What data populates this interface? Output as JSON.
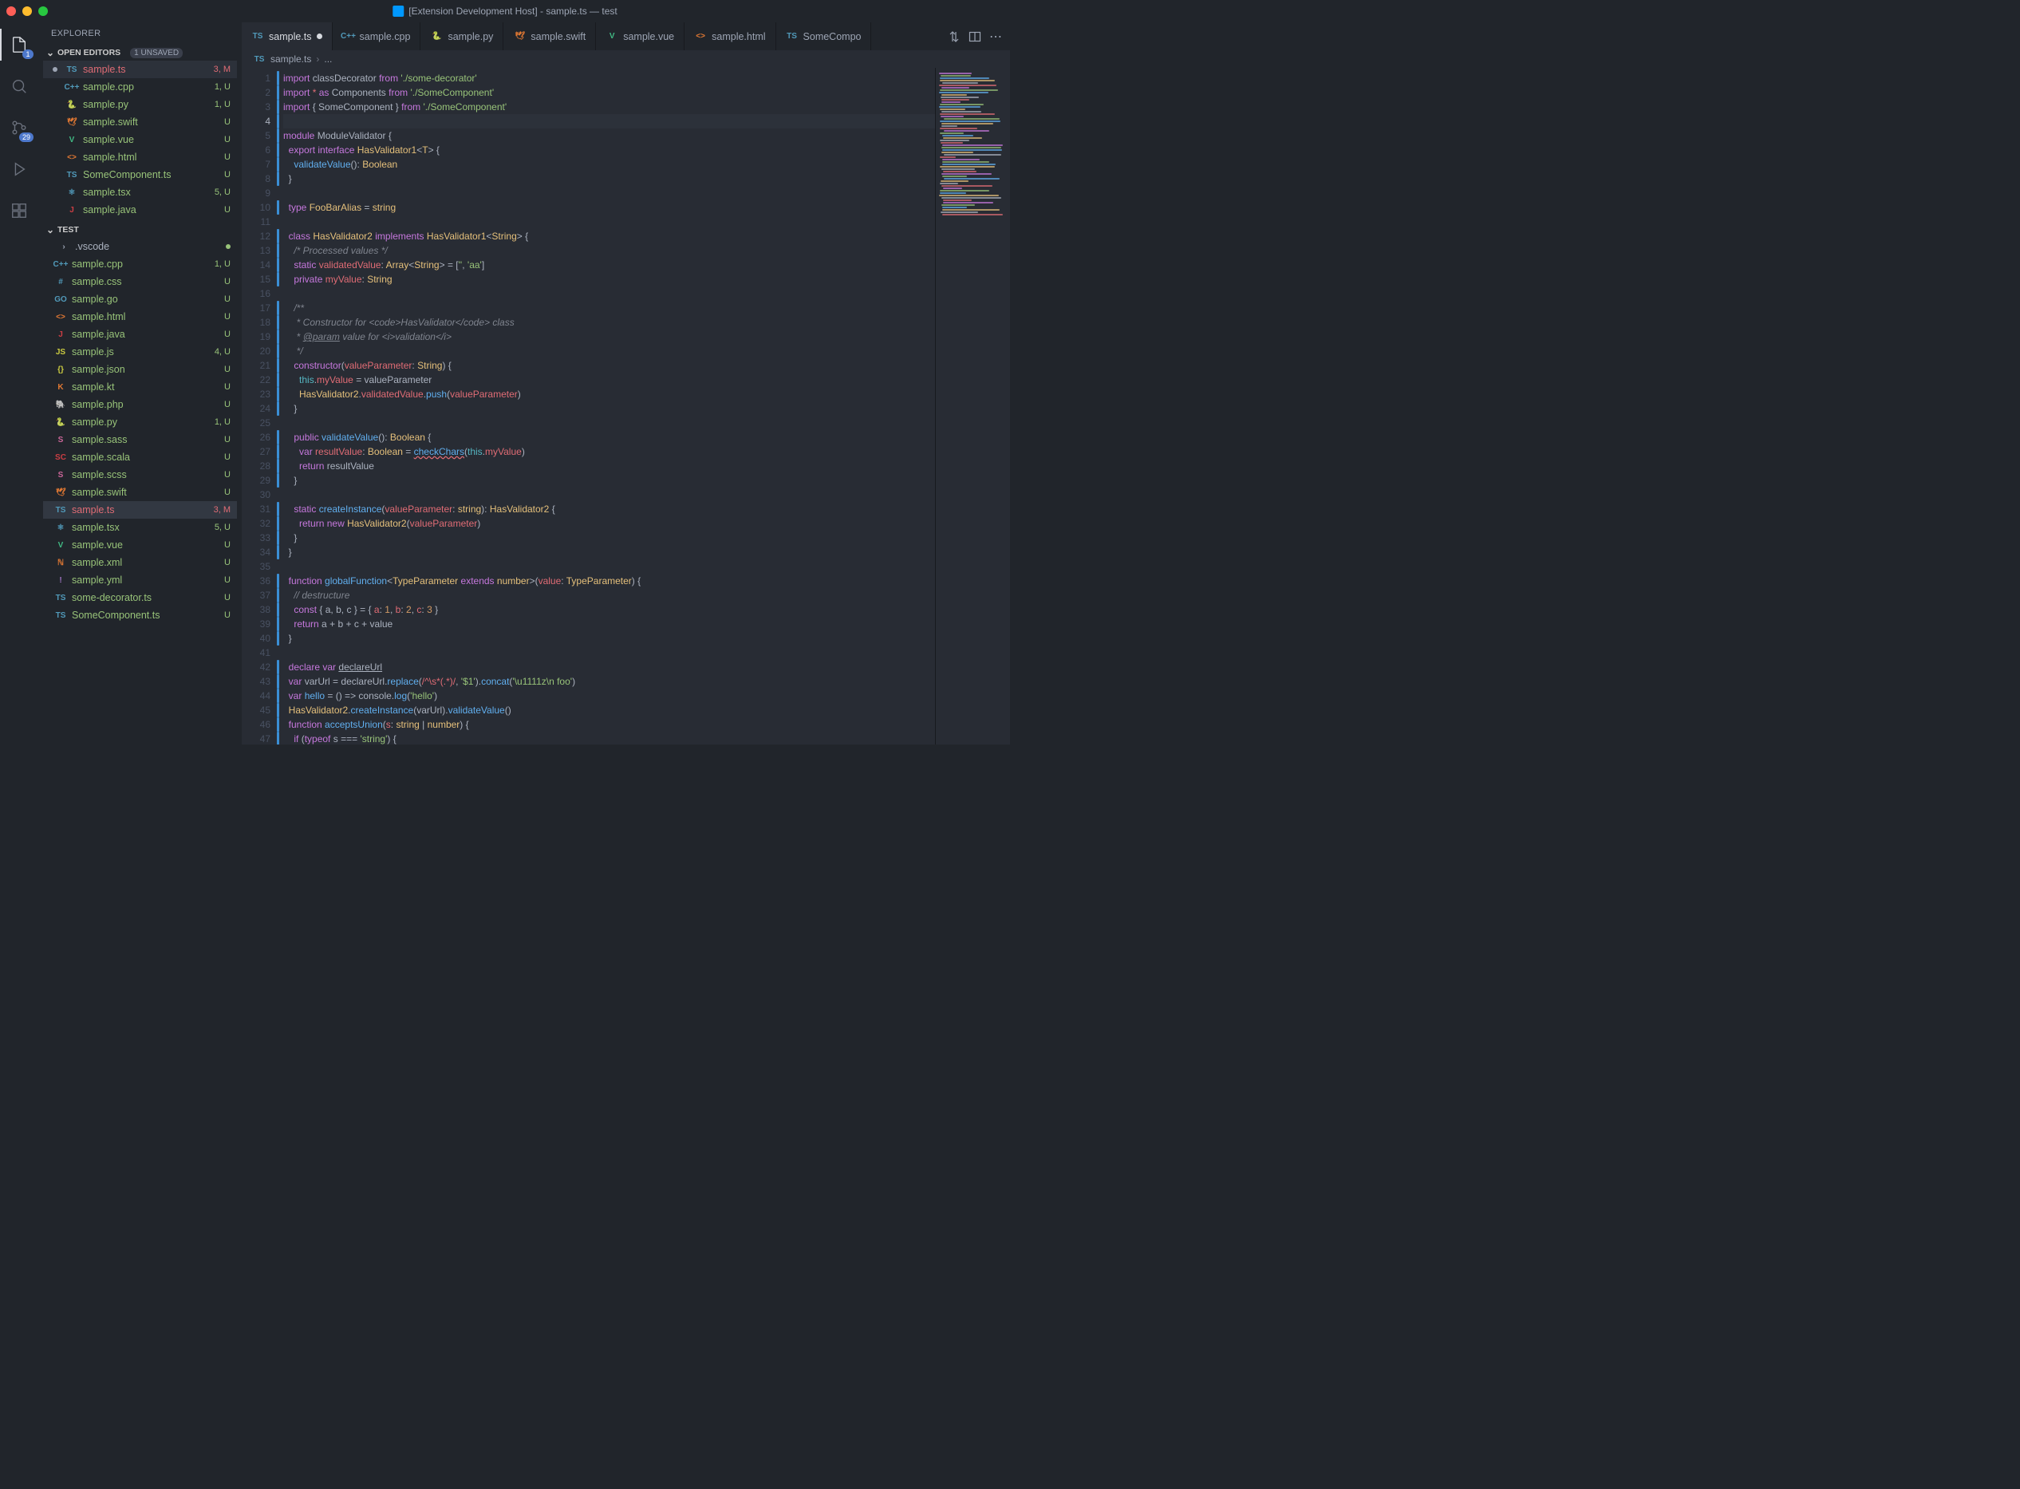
{
  "title": "[Extension Development Host] - sample.ts — test",
  "activity": {
    "explorer_badge": "1",
    "scm_badge": "29"
  },
  "sidebar": {
    "title": "EXPLORER",
    "openEditors": {
      "label": "OPEN EDITORS",
      "unsaved": "1 UNSAVED"
    },
    "editors": [
      {
        "icon": "ts",
        "name": "sample.ts",
        "meta": "3, M",
        "git": "m",
        "dirty": true
      },
      {
        "icon": "cpp",
        "name": "sample.cpp",
        "meta": "1, U",
        "git": "u"
      },
      {
        "icon": "py",
        "name": "sample.py",
        "meta": "1, U",
        "git": "u"
      },
      {
        "icon": "swift",
        "name": "sample.swift",
        "meta": "U",
        "git": "u"
      },
      {
        "icon": "vue",
        "name": "sample.vue",
        "meta": "U",
        "git": "u"
      },
      {
        "icon": "html",
        "name": "sample.html",
        "meta": "U",
        "git": "u"
      },
      {
        "icon": "ts",
        "name": "SomeComponent.ts",
        "meta": "U",
        "git": "u"
      },
      {
        "icon": "tsx",
        "name": "sample.tsx",
        "meta": "5, U",
        "git": "u"
      },
      {
        "icon": "java",
        "name": "sample.java",
        "meta": "U",
        "git": "u"
      }
    ],
    "workspace": {
      "label": "TEST"
    },
    "files": [
      {
        "icon": "folder",
        "name": ".vscode",
        "meta": "",
        "folderdot": true,
        "indent": 1
      },
      {
        "icon": "cpp",
        "name": "sample.cpp",
        "meta": "1, U",
        "git": "u"
      },
      {
        "icon": "css",
        "name": "sample.css",
        "meta": "U",
        "git": "u"
      },
      {
        "icon": "go",
        "name": "sample.go",
        "meta": "U",
        "git": "u"
      },
      {
        "icon": "html",
        "name": "sample.html",
        "meta": "U",
        "git": "u"
      },
      {
        "icon": "java",
        "name": "sample.java",
        "meta": "U",
        "git": "u"
      },
      {
        "icon": "js",
        "name": "sample.js",
        "meta": "4, U",
        "git": "u"
      },
      {
        "icon": "json",
        "name": "sample.json",
        "meta": "U",
        "git": "u"
      },
      {
        "icon": "kt",
        "name": "sample.kt",
        "meta": "U",
        "git": "u"
      },
      {
        "icon": "php",
        "name": "sample.php",
        "meta": "U",
        "git": "u"
      },
      {
        "icon": "py",
        "name": "sample.py",
        "meta": "1, U",
        "git": "u"
      },
      {
        "icon": "sass",
        "name": "sample.sass",
        "meta": "U",
        "git": "u"
      },
      {
        "icon": "scala",
        "name": "sample.scala",
        "meta": "U",
        "git": "u"
      },
      {
        "icon": "scss",
        "name": "sample.scss",
        "meta": "U",
        "git": "u"
      },
      {
        "icon": "swift",
        "name": "sample.swift",
        "meta": "U",
        "git": "u"
      },
      {
        "icon": "ts",
        "name": "sample.ts",
        "meta": "3, M",
        "git": "m",
        "sel": true
      },
      {
        "icon": "tsx",
        "name": "sample.tsx",
        "meta": "5, U",
        "git": "u"
      },
      {
        "icon": "vue",
        "name": "sample.vue",
        "meta": "U",
        "git": "u"
      },
      {
        "icon": "xml",
        "name": "sample.xml",
        "meta": "U",
        "git": "u"
      },
      {
        "icon": "yml",
        "name": "sample.yml",
        "meta": "U",
        "git": "u"
      },
      {
        "icon": "ts",
        "name": "some-decorator.ts",
        "meta": "U",
        "git": "u"
      },
      {
        "icon": "ts",
        "name": "SomeComponent.ts",
        "meta": "U",
        "git": "u"
      }
    ]
  },
  "tabs": [
    {
      "icon": "ts",
      "label": "sample.ts",
      "active": true,
      "dirty": true
    },
    {
      "icon": "cpp",
      "label": "sample.cpp"
    },
    {
      "icon": "py",
      "label": "sample.py"
    },
    {
      "icon": "swift",
      "label": "sample.swift"
    },
    {
      "icon": "vue",
      "label": "sample.vue"
    },
    {
      "icon": "html",
      "label": "sample.html"
    },
    {
      "icon": "ts",
      "label": "SomeCompo"
    }
  ],
  "breadcrumb": {
    "icon": "ts",
    "file": "sample.ts",
    "rest": "..."
  },
  "code": {
    "currentLine": 4,
    "lines": [
      {
        "n": 1,
        "bar": true,
        "h": "<span class='k'>import</span> <span class='id'>classDecorator</span> <span class='k'>from</span> <span class='s'>'./some-decorator'</span>"
      },
      {
        "n": 2,
        "bar": true,
        "h": "<span class='k'>import</span> <span class='k2'>*</span> <span class='k'>as</span> <span class='id'>Components</span> <span class='k'>from</span> <span class='s'>'./SomeComponent'</span>"
      },
      {
        "n": 3,
        "bar": true,
        "h": "<span class='k'>import</span> <span class='p'>{</span> <span class='id'>SomeComponent</span> <span class='p'>}</span> <span class='k'>from</span> <span class='s'>'./SomeComponent'</span>"
      },
      {
        "n": 4,
        "bar": true,
        "h": ""
      },
      {
        "n": 5,
        "bar": true,
        "h": "<span class='k'>module</span> <span class='id'>ModuleValidator</span> <span class='p'>{</span>"
      },
      {
        "n": 6,
        "bar": true,
        "h": "  <span class='k'>export</span> <span class='k'>interface</span> <span class='t'>HasValidator1</span><span class='p'>&lt;</span><span class='t'>T</span><span class='p'>&gt; {</span>"
      },
      {
        "n": 7,
        "bar": true,
        "h": "    <span class='fn'>validateValue</span><span class='p'>():</span> <span class='t'>Boolean</span>"
      },
      {
        "n": 8,
        "bar": true,
        "h": "  <span class='p'>}</span>"
      },
      {
        "n": 9,
        "h": ""
      },
      {
        "n": 10,
        "bar": true,
        "h": "  <span class='k'>type</span> <span class='t'>FooBarAlias</span> <span class='p'>=</span> <span class='t'>string</span>"
      },
      {
        "n": 11,
        "h": ""
      },
      {
        "n": 12,
        "bar": true,
        "h": "  <span class='k'>class</span> <span class='t'>HasValidator2</span> <span class='k'>implements</span> <span class='t'>HasValidator1</span><span class='p'>&lt;</span><span class='t'>String</span><span class='p'>&gt; {</span>"
      },
      {
        "n": 13,
        "bar": true,
        "h": "    <span class='cj'>/* Processed values */</span>"
      },
      {
        "n": 14,
        "bar": true,
        "h": "    <span class='k'>static</span> <span class='prop'>validatedValue</span><span class='p'>:</span> <span class='t'>Array</span><span class='p'>&lt;</span><span class='t'>String</span><span class='p'>&gt; = [</span><span class='s'>''</span><span class='p'>,</span> <span class='s'>'aa'</span><span class='p'>]</span>"
      },
      {
        "n": 15,
        "bar": true,
        "h": "    <span class='k'>private</span> <span class='prop'>myValue</span><span class='p'>:</span> <span class='t'>String</span>"
      },
      {
        "n": 16,
        "h": ""
      },
      {
        "n": 17,
        "bar": true,
        "h": "    <span class='cj'>/**</span>"
      },
      {
        "n": 18,
        "bar": true,
        "h": "<span class='cj'>     * Constructor for &lt;code&gt;HasValidator&lt;/code&gt; class</span>"
      },
      {
        "n": 19,
        "bar": true,
        "h": "<span class='cj'>     * <span class='under'>@param</span> value for &lt;i&gt;validation&lt;/i&gt;</span>"
      },
      {
        "n": 20,
        "bar": true,
        "h": "<span class='cj'>     */</span>"
      },
      {
        "n": 21,
        "bar": true,
        "h": "    <span class='k'>constructor</span><span class='p'>(</span><span class='prop'>valueParameter</span><span class='p'>:</span> <span class='t'>String</span><span class='p'>) {</span>"
      },
      {
        "n": 22,
        "bar": true,
        "h": "      <span class='kb'>this</span><span class='p'>.</span><span class='prop'>myValue</span> <span class='p'>=</span> <span class='id'>valueParameter</span>"
      },
      {
        "n": 23,
        "bar": true,
        "h": "      <span class='t'>HasValidator2</span><span class='p'>.</span><span class='prop'>validatedValue</span><span class='p'>.</span><span class='fn'>push</span><span class='p'>(</span><span class='prop'>valueParameter</span><span class='p'>)</span>"
      },
      {
        "n": 24,
        "bar": true,
        "h": "    <span class='p'>}</span>"
      },
      {
        "n": 25,
        "h": ""
      },
      {
        "n": 26,
        "bar": true,
        "h": "    <span class='k'>public</span> <span class='fn'>validateValue</span><span class='p'>():</span> <span class='t'>Boolean</span> <span class='p'>{</span>"
      },
      {
        "n": 27,
        "bar": true,
        "h": "      <span class='k'>var</span> <span class='prop'>resultValue</span><span class='p'>:</span> <span class='t'>Boolean</span> <span class='p'>=</span> <span class='fn err'>checkChars</span><span class='p'>(</span><span class='kb'>this</span><span class='p'>.</span><span class='prop'>myValue</span><span class='p'>)</span>"
      },
      {
        "n": 28,
        "bar": true,
        "h": "      <span class='k'>return</span> <span class='id'>resultValue</span>"
      },
      {
        "n": 29,
        "bar": true,
        "h": "    <span class='p'>}</span>"
      },
      {
        "n": 30,
        "h": ""
      },
      {
        "n": 31,
        "bar": true,
        "h": "    <span class='k'>static</span> <span class='fn'>createInstance</span><span class='p'>(</span><span class='prop'>valueParameter</span><span class='p'>:</span> <span class='t'>string</span><span class='p'>):</span> <span class='t'>HasValidator2</span> <span class='p'>{</span>"
      },
      {
        "n": 32,
        "bar": true,
        "h": "      <span class='k'>return</span> <span class='k'>new</span> <span class='t'>HasValidator2</span><span class='p'>(</span><span class='prop'>valueParameter</span><span class='p'>)</span>"
      },
      {
        "n": 33,
        "bar": true,
        "h": "    <span class='p'>}</span>"
      },
      {
        "n": 34,
        "bar": true,
        "h": "  <span class='p'>}</span>"
      },
      {
        "n": 35,
        "h": ""
      },
      {
        "n": 36,
        "bar": true,
        "h": "  <span class='k'>function</span> <span class='fn'>globalFunction</span><span class='p'>&lt;</span><span class='t'>TypeParameter</span> <span class='k'>extends</span> <span class='t'>number</span><span class='p'>&gt;(</span><span class='prop'>value</span><span class='p'>:</span> <span class='t'>TypeParameter</span><span class='p'>) {</span>"
      },
      {
        "n": 37,
        "bar": true,
        "h": "    <span class='c'>// destructure</span>"
      },
      {
        "n": 38,
        "bar": true,
        "h": "    <span class='k'>const</span> <span class='p'>{</span> <span class='id'>a</span><span class='p'>,</span> <span class='id'>b</span><span class='p'>,</span> <span class='id'>c</span> <span class='p'>} = {</span> <span class='prop'>a</span><span class='p'>:</span> <span class='n'>1</span><span class='p'>,</span> <span class='prop'>b</span><span class='p'>:</span> <span class='n'>2</span><span class='p'>,</span> <span class='prop'>c</span><span class='p'>:</span> <span class='n'>3</span> <span class='p'>}</span>"
      },
      {
        "n": 39,
        "bar": true,
        "h": "    <span class='k'>return</span> <span class='id'>a</span> <span class='p'>+</span> <span class='id'>b</span> <span class='p'>+</span> <span class='id'>c</span> <span class='p'>+</span> <span class='id'>value</span>"
      },
      {
        "n": 40,
        "bar": true,
        "h": "  <span class='p'>}</span>"
      },
      {
        "n": 41,
        "h": ""
      },
      {
        "n": 42,
        "bar": true,
        "h": "  <span class='k'>declare</span> <span class='k'>var</span> <span class='id under'>declareUrl</span>"
      },
      {
        "n": 43,
        "bar": true,
        "h": "  <span class='k'>var</span> <span class='id'>varUrl</span> <span class='p'>=</span> <span class='id'>declareUrl</span><span class='p'>.</span><span class='fn'>replace</span><span class='p'>(</span><span class='prop'>/^\\s*(.*)/</span><span class='p'>,</span> <span class='s'>'$1'</span><span class='p'>).</span><span class='fn'>concat</span><span class='p'>(</span><span class='s'>'\\u1111z\\n foo'</span><span class='p'>)</span>"
      },
      {
        "n": 44,
        "bar": true,
        "h": "  <span class='k'>var</span> <span class='fn'>hello</span> <span class='p'>= () =&gt;</span> <span class='id'>console</span><span class='p'>.</span><span class='fn'>log</span><span class='p'>(</span><span class='s'>'hello'</span><span class='p'>)</span>"
      },
      {
        "n": 45,
        "bar": true,
        "h": "  <span class='t'>HasValidator2</span><span class='p'>.</span><span class='fn'>createInstance</span><span class='p'>(</span><span class='id'>varUrl</span><span class='p'>).</span><span class='fn'>validateValue</span><span class='p'>()</span>"
      },
      {
        "n": 46,
        "bar": true,
        "h": "  <span class='k'>function</span> <span class='fn'>acceptsUnion</span><span class='p'>(</span><span class='prop'>s</span><span class='p'>:</span> <span class='t'>string</span> <span class='p'>|</span> <span class='t'>number</span><span class='p'>) {</span>"
      },
      {
        "n": 47,
        "bar": true,
        "h": "    <span class='k'>if</span> <span class='p'>(</span><span class='k'>typeof</span> <span class='id'>s</span> <span class='p'>===</span> <span class='s'>'string'</span><span class='p'>) {</span>"
      }
    ]
  },
  "ic": {
    "ts": "TS",
    "cpp": "C++",
    "py": "🐍",
    "swift": "🕊",
    "vue": "V",
    "html": "<>",
    "java": "J",
    "tsx": "⚛",
    "css": "#",
    "go": "GO",
    "js": "JS",
    "json": "{}",
    "kt": "K",
    "php": "🐘",
    "sass": "S",
    "scala": "SC",
    "scss": "S",
    "xml": "ℕ",
    "yml": "!",
    "folder": "›"
  }
}
